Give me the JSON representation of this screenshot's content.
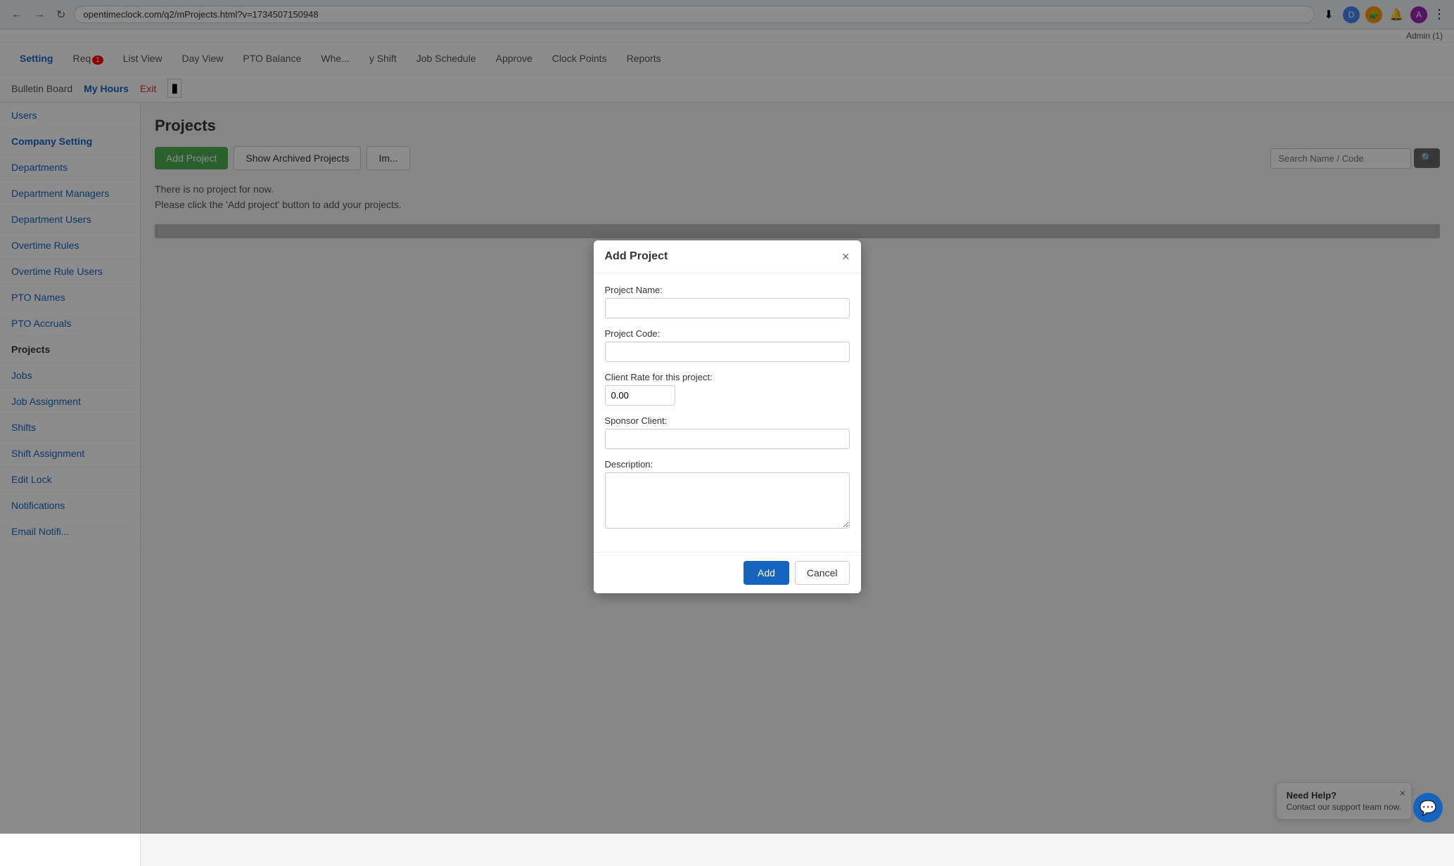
{
  "browser": {
    "url": "opentimeclock.com/q2/mProjects.html?v=1734507150948",
    "back_btn": "←",
    "forward_btn": "→",
    "refresh_btn": "↻",
    "icons": [
      "D",
      "🧩",
      "🔔",
      "A"
    ],
    "admin_label": "Admin (1)"
  },
  "nav": {
    "items": [
      {
        "label": "Setting",
        "active": true
      },
      {
        "label": "Req",
        "badge": "1"
      },
      {
        "label": "List View"
      },
      {
        "label": "Day View"
      },
      {
        "label": "PTO Balance"
      },
      {
        "label": "Whe..."
      },
      {
        "label": "y Shift"
      },
      {
        "label": "Job Schedule"
      },
      {
        "label": "Approve"
      },
      {
        "label": "Clock Points"
      },
      {
        "label": "Reports"
      }
    ],
    "sub_items": [
      {
        "label": "Bulletin Board"
      },
      {
        "label": "My Hours",
        "color": "blue"
      },
      {
        "label": "Exit",
        "color": "red"
      }
    ]
  },
  "sidebar": {
    "items": [
      {
        "label": "Users"
      },
      {
        "label": "Company Setting",
        "active": true
      },
      {
        "label": "Departments"
      },
      {
        "label": "Department Managers"
      },
      {
        "label": "Department Users"
      },
      {
        "label": "Overtime Rules"
      },
      {
        "label": "Overtime Rule Users"
      },
      {
        "label": "PTO Names"
      },
      {
        "label": "PTO Accruals"
      },
      {
        "label": "Projects",
        "current": true
      },
      {
        "label": "Jobs"
      },
      {
        "label": "Job Assignment"
      },
      {
        "label": "Shifts"
      },
      {
        "label": "Shift Assignment"
      },
      {
        "label": "Edit Lock"
      },
      {
        "label": "Notifications"
      },
      {
        "label": "Email Notifi..."
      }
    ]
  },
  "content": {
    "page_title": "Projects",
    "add_project_btn": "Add Project",
    "show_archived_btn": "Show Archived Projects",
    "import_btn": "Im...",
    "search_placeholder": "Search Name / Code",
    "empty_line1": "There is no project for now.",
    "empty_line2": "Please click the 'Add project' button to add your projects."
  },
  "modal": {
    "title": "Add Project",
    "fields": [
      {
        "label": "Project Name:",
        "type": "text",
        "value": "",
        "id": "project_name"
      },
      {
        "label": "Project Code:",
        "type": "text",
        "value": "",
        "id": "project_code"
      },
      {
        "label": "Client Rate for this project:",
        "type": "text_sm",
        "value": "0.00",
        "id": "client_rate"
      },
      {
        "label": "Sponsor Client:",
        "type": "text",
        "value": "",
        "id": "sponsor_client"
      },
      {
        "label": "Description:",
        "type": "textarea",
        "value": "",
        "id": "description"
      }
    ],
    "add_btn": "Add",
    "cancel_btn": "Cancel",
    "close_icon": "×"
  },
  "help": {
    "title": "Need Help?",
    "subtitle": "Contact our support team now.",
    "close": "×"
  }
}
